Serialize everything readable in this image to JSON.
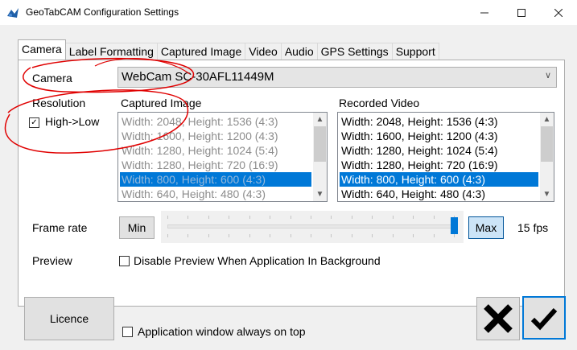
{
  "window": {
    "title": "GeoTabCAM Configuration Settings"
  },
  "tabs": [
    "Camera",
    "Label Formatting",
    "Captured Image",
    "Video",
    "Audio",
    "GPS Settings",
    "Support"
  ],
  "camera": {
    "label": "Camera",
    "selected": "WebCam SC-30AFL11449M"
  },
  "resolution": {
    "label": "Resolution",
    "checkbox_label": "High->Low",
    "checked": true
  },
  "captured_image": {
    "label": "Captured Image",
    "items": [
      "Width: 2048, Height: 1536 (4:3)",
      "Width: 1600, Height: 1200 (4:3)",
      "Width: 1280, Height: 1024 (5:4)",
      "Width: 1280, Height: 720 (16:9)",
      "Width: 800, Height: 600 (4:3)",
      "Width: 640, Height: 480 (4:3)"
    ],
    "selected_index": 4
  },
  "recorded_video": {
    "label": "Recorded Video",
    "items": [
      "Width: 2048, Height: 1536 (4:3)",
      "Width: 1600, Height: 1200 (4:3)",
      "Width: 1280, Height: 1024 (5:4)",
      "Width: 1280, Height: 720 (16:9)",
      "Width: 800, Height: 600 (4:3)",
      "Width: 640, Height: 480 (4:3)"
    ],
    "selected_index": 4
  },
  "frame_rate": {
    "label": "Frame rate",
    "min_label": "Min",
    "max_label": "Max",
    "value_label": "15 fps",
    "slider_fraction": 1.0
  },
  "preview": {
    "label": "Preview",
    "checkbox_label": "Disable Preview When Application In Background",
    "checked": false
  },
  "footer": {
    "licence_label": "Licence",
    "always_on_top_label": "Application window always on top",
    "always_on_top_checked": false
  },
  "colors": {
    "accent": "#0078d7",
    "annotation": "#e00000"
  }
}
